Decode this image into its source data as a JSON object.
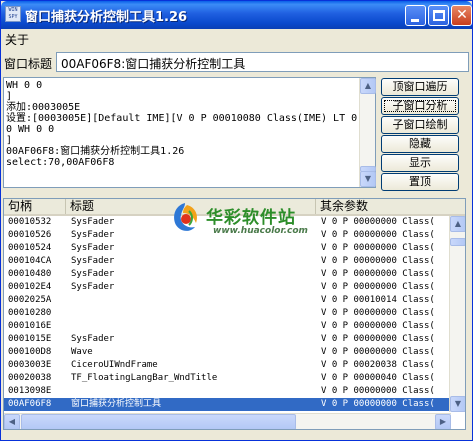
{
  "window": {
    "title": "窗口捕获分析控制工具1.26",
    "icon_text": "WIN SPY",
    "minimize_icon": "minimize-icon",
    "maximize_icon": "maximize-icon",
    "close_icon": "close-icon"
  },
  "menu": {
    "about": "关于"
  },
  "caption": {
    "label": "窗口标题",
    "value": "00AF06F8:窗口捕获分析控制工具"
  },
  "log": {
    "text": "WH 0 0\n]\n添加:0003005E\n设置:[0003005E][Default IME][V 0 P 00010080 Class(IME) LT 0\n0 WH 0 0\n]\n00AF06F8:窗口捕获分析控制工具1.26\nselect:70,00AF06F8"
  },
  "buttons": {
    "top_window_traverse": "顶窗口遍历",
    "child_window_analyze": "子窗口分析",
    "child_window_draw": "子窗口绘制",
    "hide": "隐藏",
    "show": "显示",
    "topmost": "置顶"
  },
  "table": {
    "columns": [
      "句柄",
      "标题",
      "其余参数"
    ],
    "rows": [
      [
        "00010532",
        "SysFader",
        "V 0 P 00000000 Class("
      ],
      [
        "00010526",
        "SysFader",
        "V 0 P 00000000 Class("
      ],
      [
        "00010524",
        "SysFader",
        "V 0 P 00000000 Class("
      ],
      [
        "000104CA",
        "SysFader",
        "V 0 P 00000000 Class("
      ],
      [
        "00010480",
        "SysFader",
        "V 0 P 00000000 Class("
      ],
      [
        "000102E4",
        "SysFader",
        "V 0 P 00000000 Class("
      ],
      [
        "0002025A",
        "",
        "V 0 P 00010014 Class("
      ],
      [
        "00010280",
        "",
        "V 0 P 00000000 Class("
      ],
      [
        "0001016E",
        "",
        "V 0 P 00000000 Class("
      ],
      [
        "0001015E",
        "SysFader",
        "V 0 P 00000000 Class("
      ],
      [
        "000100D8",
        "Wave",
        "V 0 P 00000000 Class("
      ],
      [
        "0003003E",
        "CiceroUIWndFrame",
        "V 0 P 00020038 Class("
      ],
      [
        "00020038",
        "TF_FloatingLangBar_WndTitle",
        "V 0 P 00000040 Class("
      ],
      [
        "0013098E",
        "",
        "V 0 P 00000000 Class("
      ],
      [
        "00AF06F8",
        "窗口捕获分析控制工具",
        "V 0 P 00000000 Class("
      ]
    ],
    "selected_row": 14
  },
  "watermark": {
    "name": "华彩软件站",
    "url": "www.huacolor.com"
  },
  "colors": {
    "titlebar": "#0a49cc",
    "selection": "#316ac5",
    "window_bg": "#ece9d8",
    "watermark_green": "#2d8e2a"
  }
}
